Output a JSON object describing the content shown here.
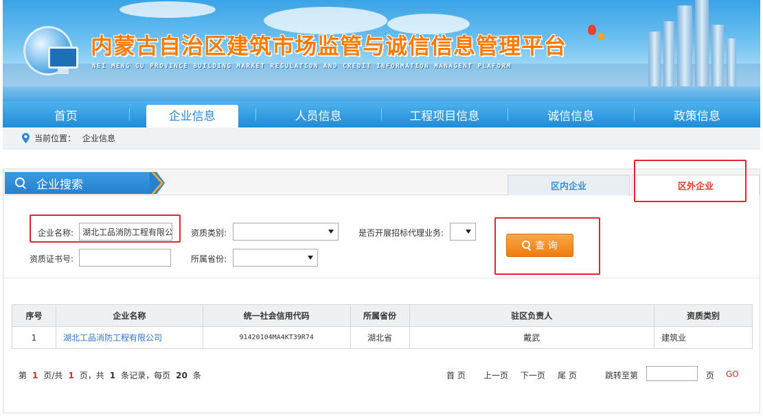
{
  "banner": {
    "title": "内蒙古自治区建筑市场监管与诚信信息管理平台",
    "subtitle": "NEI MENG GU PROVINCE BUILDING MARKET REGULATION AND CREDIT INFORMATION MANAGENT PLAFORM"
  },
  "nav": {
    "items": [
      {
        "label": "首页"
      },
      {
        "label": "企业信息"
      },
      {
        "label": "人员信息"
      },
      {
        "label": "工程项目信息"
      },
      {
        "label": "诚信信息"
      },
      {
        "label": "政策信息"
      }
    ]
  },
  "breadcrumb": {
    "prefix": "当前位置：",
    "current": "企业信息"
  },
  "search": {
    "title": "企业搜索",
    "tabs": {
      "inner": "区内企业",
      "outer": "区外企业"
    },
    "fields": {
      "company_name_label": "企业名称:",
      "company_name_value": "湖北工品消防工程有限公",
      "qual_type_label": "资质类别:",
      "agency_label": "是否开展招标代理业务:",
      "cert_no_label": "资质证书号:",
      "province_label": "所属省份:"
    },
    "query_button": "查 询"
  },
  "table": {
    "headers": [
      "序号",
      "企业名称",
      "统一社会信用代码",
      "所属省份",
      "驻区负责人",
      "资质类别"
    ],
    "rows": [
      [
        "1",
        "湖北工品消防工程有限公司",
        "91420104MA4KT39R74",
        "湖北省",
        "戴武",
        "建筑业"
      ]
    ]
  },
  "pager": {
    "t1": "第",
    "page": "1",
    "t2": "页/共",
    "pages": "1",
    "t3": "页，共",
    "records": "1",
    "t4": "条记录，每页",
    "per_page": "20",
    "t5": "条",
    "first": "首 页",
    "prev": "上一页",
    "next": "下一页",
    "last": "尾 页",
    "jump_label": "跳转至第",
    "page_unit": "页",
    "go": "GO"
  },
  "colors": {
    "accent": "#2b89d6",
    "highlight_red": "#e5232b",
    "button_orange": "#f0841a"
  }
}
